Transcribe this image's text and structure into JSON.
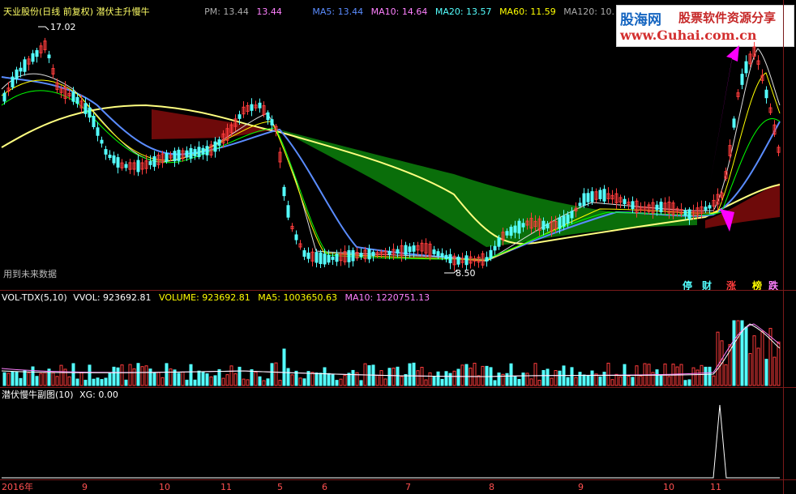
{
  "header": {
    "title": "天业股份(日线 前复权) 潜伏主升慢牛",
    "pm": "PM: 13.44",
    "pm_value": "13.44",
    "ma5": "MA5: 13.44",
    "ma10": "MA10: 14.64",
    "ma20": "MA20: 13.57",
    "ma60": "MA60: 11.59",
    "ma120": "MA120: 10."
  },
  "price_labels": {
    "high": "17.02",
    "low": "8.50"
  },
  "future_data_note": "用到未来数据",
  "signal_badges": [
    "停",
    "财",
    "涨",
    "榜",
    "跌"
  ],
  "volume_header": {
    "name": "VOL-TDX(5,10)",
    "vvol": "VVOL: 923692.81",
    "volume": "VOLUME: 923692.81",
    "ma5": "MA5: 1003650.63",
    "ma10": "MA10: 1220751.13"
  },
  "sub_header": {
    "name": "潜伏慢牛副图(10)",
    "xg": "XG: 0.00"
  },
  "time_axis": [
    "2016年",
    "9",
    "10",
    "11",
    "5",
    "6",
    "7",
    "8",
    "9",
    "10",
    "11"
  ],
  "watermark": {
    "brand": "股海网",
    "tagline": "股票软件资源分享",
    "url": "www.Guhai.com.cn"
  },
  "colors": {
    "up": "#ff3c3c",
    "down": "#54ffff",
    "ma5": "#ffffff",
    "ma10": "#ffff00",
    "ma20": "#ff80ff",
    "ma60": "#00ff00",
    "ma_blue": "#5a8cff",
    "band_green": "#0a6e0a",
    "band_red": "#6e0a0a",
    "yellow_line": "#ffff80"
  }
}
